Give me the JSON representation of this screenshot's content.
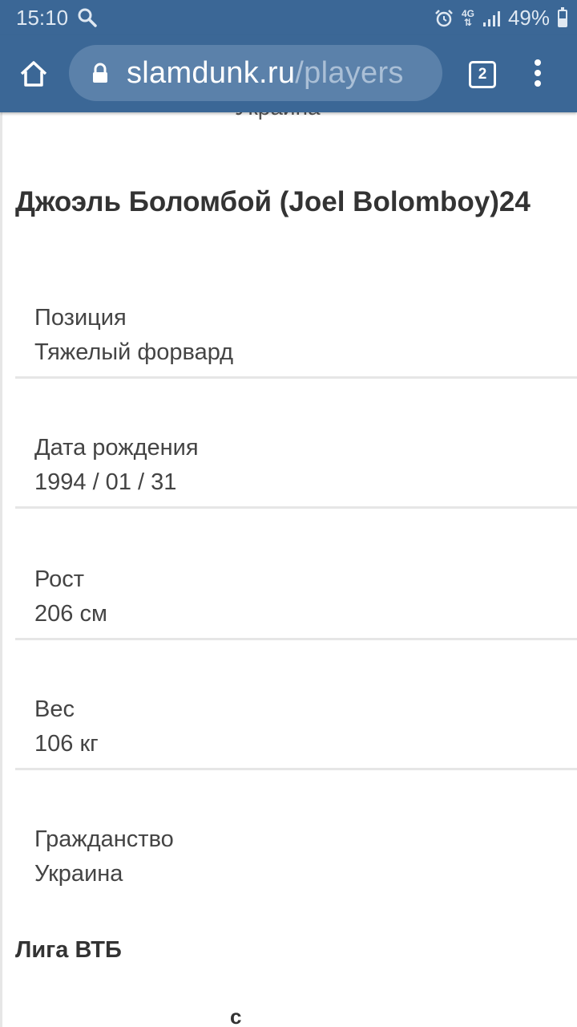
{
  "status_bar": {
    "time": "15:10",
    "network_type": "4G",
    "battery_percent": "49%",
    "battery_level": 0.49,
    "icons": [
      "search-icon",
      "alarm-icon",
      "signal-icon",
      "battery-icon"
    ]
  },
  "browser": {
    "url_domain": "slamdunk.ru",
    "url_path": "/players",
    "tab_count": "2",
    "toolbar_color": "#3b6796",
    "icons": [
      "home-icon",
      "lock-icon",
      "tabs-icon",
      "overflow-menu-icon"
    ]
  },
  "page": {
    "cut_top_text": "Украина",
    "player_name": "Джоэль Боломбой (Joel Bolomboy)24",
    "fields": [
      {
        "label": "Позиция",
        "value": "Тяжелый форвард"
      },
      {
        "label": "Дата рождения",
        "value": "1994 / 01 / 31"
      },
      {
        "label": "Рост",
        "value": "206 см"
      },
      {
        "label": "Вес",
        "value": "106 кг"
      },
      {
        "label": "Гражданство",
        "value": "Украина"
      }
    ],
    "league_heading": "Лига ВТБ",
    "cut_bottom_text": "с",
    "cut_bottom_text_2": "."
  }
}
